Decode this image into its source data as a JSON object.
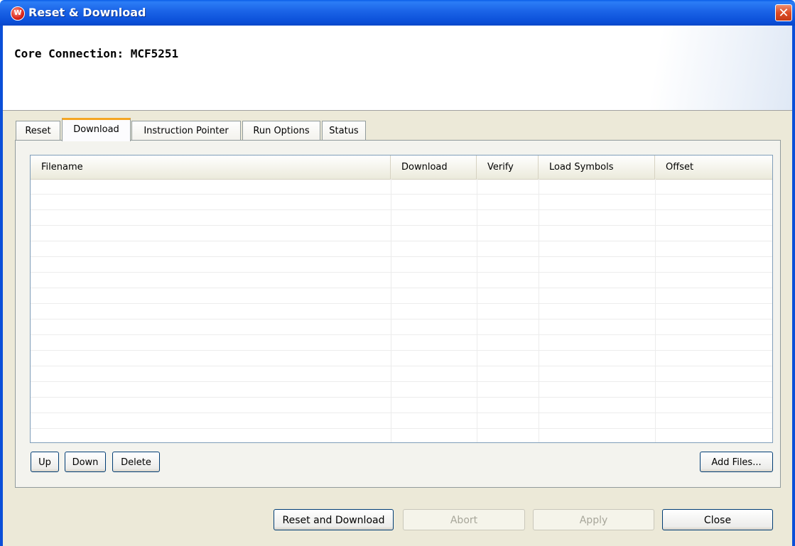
{
  "window": {
    "title": "Reset & Download",
    "app_icon": "wind-river-icon",
    "close_label": "✕"
  },
  "header": {
    "core_connection": "Core Connection: MCF5251"
  },
  "tabs": [
    {
      "label": "Reset",
      "active": false
    },
    {
      "label": "Download",
      "active": true
    },
    {
      "label": "Instruction Pointer",
      "active": false
    },
    {
      "label": "Run Options",
      "active": false
    },
    {
      "label": "Status",
      "active": false
    }
  ],
  "table": {
    "columns": [
      "Filename",
      "Download",
      "Verify",
      "Load Symbols",
      "Offset"
    ],
    "rows": []
  },
  "list_buttons": {
    "up": "Up",
    "down": "Down",
    "delete": "Delete",
    "add_files": "Add Files..."
  },
  "dialog_buttons": {
    "reset_and_download": "Reset and Download",
    "abort": "Abort",
    "apply": "Apply",
    "close": "Close"
  },
  "colors": {
    "titlebar": "#0b4fd8",
    "active_tab_accent": "#f5a623",
    "dialog_bg": "#ece9d8"
  }
}
